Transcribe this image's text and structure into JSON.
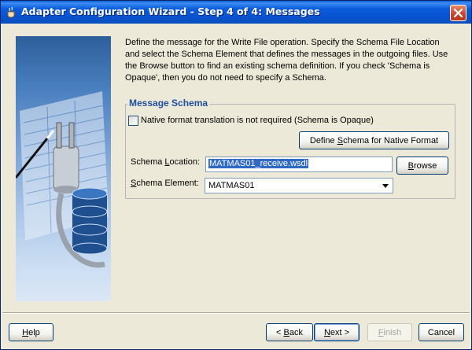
{
  "window": {
    "title": "Adapter Configuration Wizard - Step 4 of 4: Messages"
  },
  "description": "Define the message for the Write File operation. Specify the Schema File Location and select the Schema Element that defines the messages in the outgoing files. Use the Browse button to find an existing schema definition. If you check 'Schema is Opaque', then you do not need to specify a Schema.",
  "message_schema": {
    "group_title": "Message Schema",
    "opaque_checkbox": {
      "label": "Native format translation is not required (Schema is Opaque)",
      "checked": false
    },
    "define_button": {
      "pre": "Define ",
      "mnemonic": "S",
      "post": "chema for Native Format"
    },
    "schema_location": {
      "label_pre": "Schema ",
      "label_mnemonic": "L",
      "label_post": "ocation:",
      "value": "MATMAS01_receive.wsdl"
    },
    "browse_button": {
      "mnemonic": "B",
      "post": "rowse"
    },
    "schema_element": {
      "label_mnemonic": "S",
      "label_post": "chema Element:",
      "value": "MATMAS01"
    }
  },
  "footer": {
    "help": {
      "mnemonic": "H",
      "post": "elp"
    },
    "back": {
      "pre": "< ",
      "mnemonic": "B",
      "post": "ack"
    },
    "next": {
      "mnemonic": "N",
      "post": "ext >"
    },
    "finish": {
      "mnemonic": "F",
      "post": "inish"
    },
    "cancel": {
      "label": "Cancel"
    }
  },
  "icons": {
    "title": "coffee-cup-icon",
    "close": "close-icon",
    "side": "plug-and-database-illustration"
  }
}
